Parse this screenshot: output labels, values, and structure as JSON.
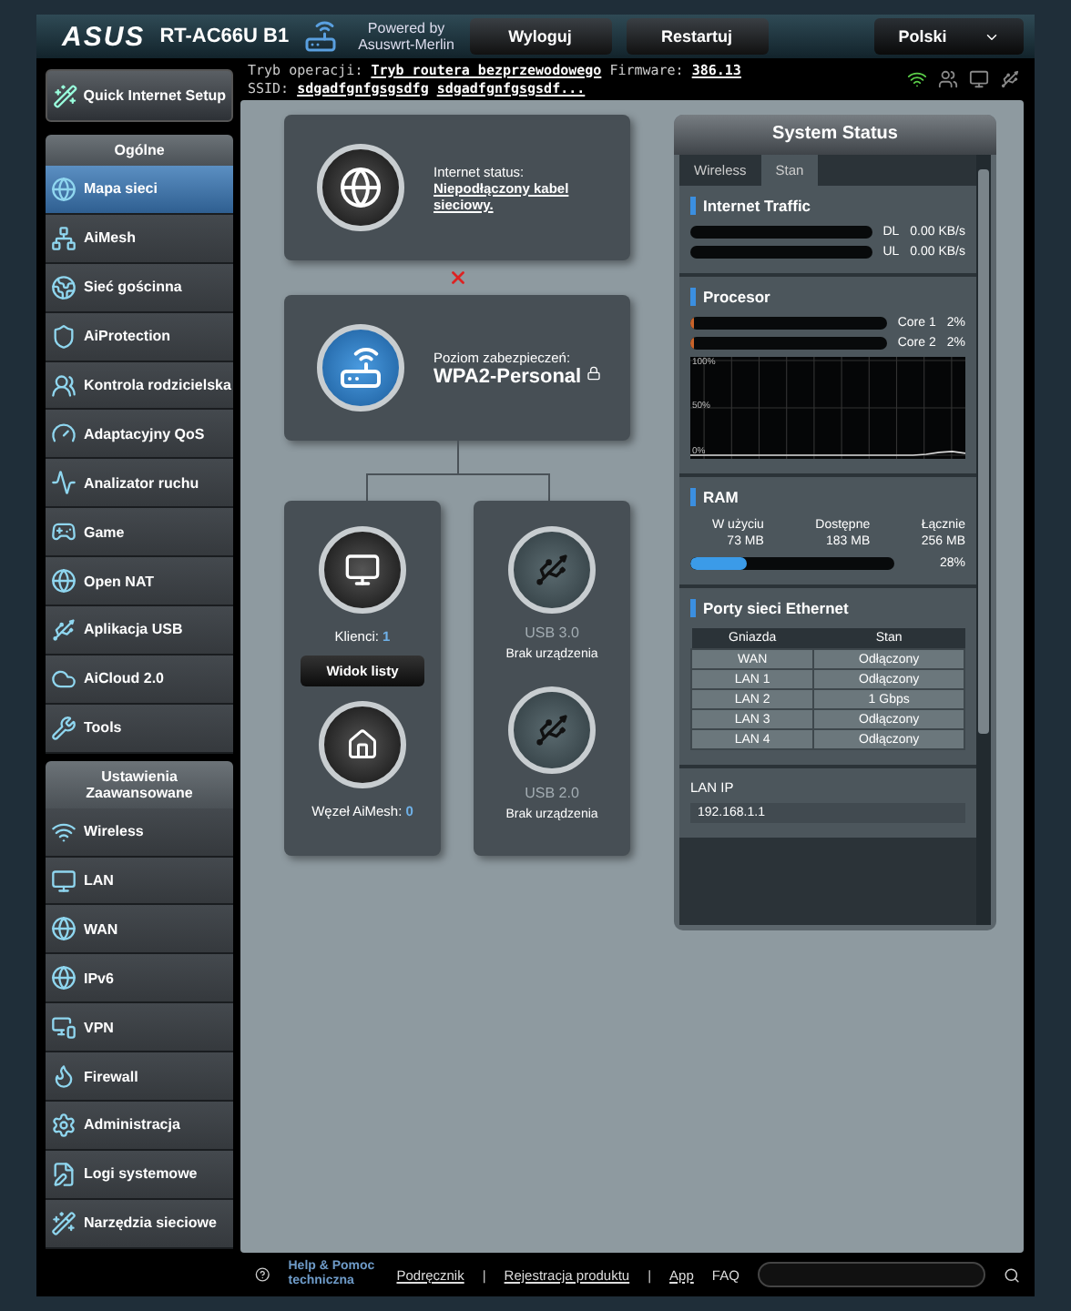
{
  "header": {
    "logo": "ASUS",
    "model": "RT-AC66U B1",
    "powered_by": "Powered by",
    "firmware_brand": "Asuswrt-Merlin",
    "buttons": [
      "Wyloguj",
      "Restartuj"
    ],
    "language": "Polski"
  },
  "info_bar": {
    "mode_label": "Tryb operacji:",
    "mode": "Tryb routera bezprzewodowego",
    "firmware_label": "Firmware:",
    "firmware": "386.13",
    "ssid_label": "SSID:",
    "ssids": [
      "sdgadfgnfgsgsdfg",
      "sdgadfgnfgsgsdf..."
    ]
  },
  "sidebar": {
    "quick_setup": "Quick Internet Setup",
    "sections": [
      {
        "title": "Ogólne",
        "items": [
          {
            "label": "Mapa sieci",
            "selected": true
          },
          {
            "label": "AiMesh",
            "selected": false
          },
          {
            "label": "Sieć gościnna",
            "selected": false
          },
          {
            "label": "AiProtection",
            "selected": false
          },
          {
            "label": "Kontrola rodzicielska",
            "selected": false
          },
          {
            "label": "Adaptacyjny QoS",
            "selected": false
          },
          {
            "label": "Analizator ruchu",
            "selected": false
          },
          {
            "label": "Game",
            "selected": false
          },
          {
            "label": "Open NAT",
            "selected": false
          },
          {
            "label": "Aplikacja USB",
            "selected": false
          },
          {
            "label": "AiCloud 2.0",
            "selected": false
          },
          {
            "label": "Tools",
            "selected": false
          }
        ]
      },
      {
        "title": "Ustawienia Zaawansowane",
        "items": [
          {
            "label": "Wireless",
            "selected": false
          },
          {
            "label": "LAN",
            "selected": false
          },
          {
            "label": "WAN",
            "selected": false
          },
          {
            "label": "IPv6",
            "selected": false
          },
          {
            "label": "VPN",
            "selected": false
          },
          {
            "label": "Firewall",
            "selected": false
          },
          {
            "label": "Administracja",
            "selected": false
          },
          {
            "label": "Logi systemowe",
            "selected": false
          },
          {
            "label": "Narzędzia sieciowe",
            "selected": false
          }
        ]
      }
    ]
  },
  "network_map": {
    "internet": {
      "label": "Internet status:",
      "value": "Niepodłączony kabel sieciowy.",
      "connected": false
    },
    "router": {
      "label": "Poziom zabezpieczeń:",
      "value": "WPA2-Personal"
    },
    "clients": {
      "label": "Klienci:",
      "count": "1",
      "button": "Widok listy"
    },
    "aimesh": {
      "label": "Węzeł AiMesh:",
      "count": "0"
    },
    "usb": [
      {
        "name": "USB 3.0",
        "status": "Brak urządzenia"
      },
      {
        "name": "USB 2.0",
        "status": "Brak urządzenia"
      }
    ]
  },
  "system_status": {
    "title": "System Status",
    "tabs": [
      {
        "label": "Wireless",
        "selected": false
      },
      {
        "label": "Stan",
        "selected": true
      }
    ],
    "traffic": {
      "title": "Internet Traffic",
      "rows": [
        {
          "label": "DL",
          "value": "0.00 KB/s",
          "level": 0
        },
        {
          "label": "UL",
          "value": "0.00 KB/s",
          "level": 0
        }
      ]
    },
    "cpu": {
      "title": "Procesor",
      "cores": [
        {
          "label": "Core 1",
          "value": "2%",
          "level": 0.02
        },
        {
          "label": "Core 2",
          "value": "2%",
          "level": 0.02
        }
      ],
      "chart_data": {
        "type": "line",
        "grid": true,
        "ylim": [
          0,
          100
        ],
        "yticks": [
          {
            "value": 0,
            "label": "0%"
          },
          {
            "value": 50,
            "label": "50%"
          },
          {
            "value": 100,
            "label": "100%"
          }
        ],
        "series": [
          {
            "color": "#d8d8d8",
            "values": [
              0,
              0,
              0,
              0,
              0,
              0,
              0,
              0,
              0,
              0,
              0,
              0,
              0,
              0,
              0,
              0,
              0,
              0,
              1,
              3,
              4,
              2
            ]
          }
        ]
      }
    },
    "ram": {
      "title": "RAM",
      "stats": [
        {
          "label": "W użyciu",
          "value": "73 MB"
        },
        {
          "label": "Dostępne",
          "value": "183 MB"
        },
        {
          "label": "Łącznie",
          "value": "256 MB"
        }
      ],
      "level": 0.28,
      "percent": "28%"
    },
    "ethernet": {
      "title": "Porty sieci Ethernet",
      "columns": [
        "Gniazda",
        "Stan"
      ],
      "rows": [
        [
          "WAN",
          "Odłączony"
        ],
        [
          "LAN 1",
          "Odłączony"
        ],
        [
          "LAN 2",
          "1 Gbps"
        ],
        [
          "LAN 3",
          "Odłączony"
        ],
        [
          "LAN 4",
          "Odłączony"
        ]
      ]
    },
    "lan_ip": {
      "label": "LAN IP",
      "value": "192.168.1.1"
    }
  },
  "footer": {
    "help": "Help & Pomoc techniczna",
    "links": [
      "Podręcznik",
      "Rejestracja produktu",
      "App"
    ],
    "separator": "|",
    "faq": "FAQ"
  }
}
